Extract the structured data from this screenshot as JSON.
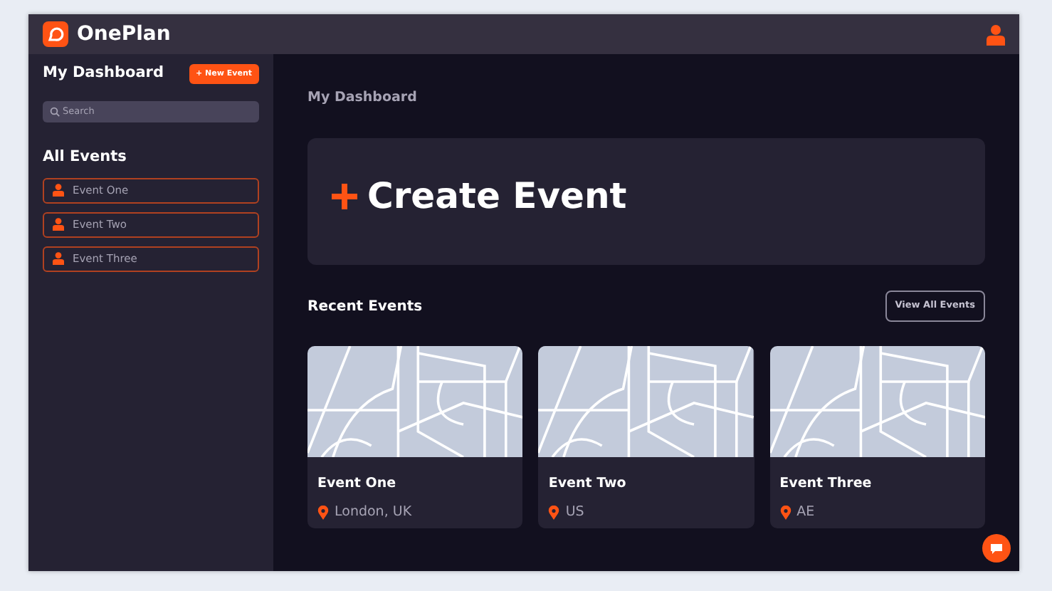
{
  "app": {
    "title": "OnePlan"
  },
  "sidebar": {
    "title": "My Dashboard",
    "new_event_button": "+ New Event",
    "search": {
      "placeholder": "Search"
    },
    "section_title": "All Events",
    "events": [
      {
        "label": "Event One"
      },
      {
        "label": "Event Two"
      },
      {
        "label": "Event Three"
      }
    ]
  },
  "main": {
    "heading": "My Dashboard",
    "create_label": "Create Event",
    "recent_title": "Recent Events",
    "view_all_button": "View All Events",
    "cards": [
      {
        "title": "Event One",
        "location": "London, UK"
      },
      {
        "title": "Event Two",
        "location": "US"
      },
      {
        "title": "Event Three",
        "location": "AE"
      }
    ]
  }
}
